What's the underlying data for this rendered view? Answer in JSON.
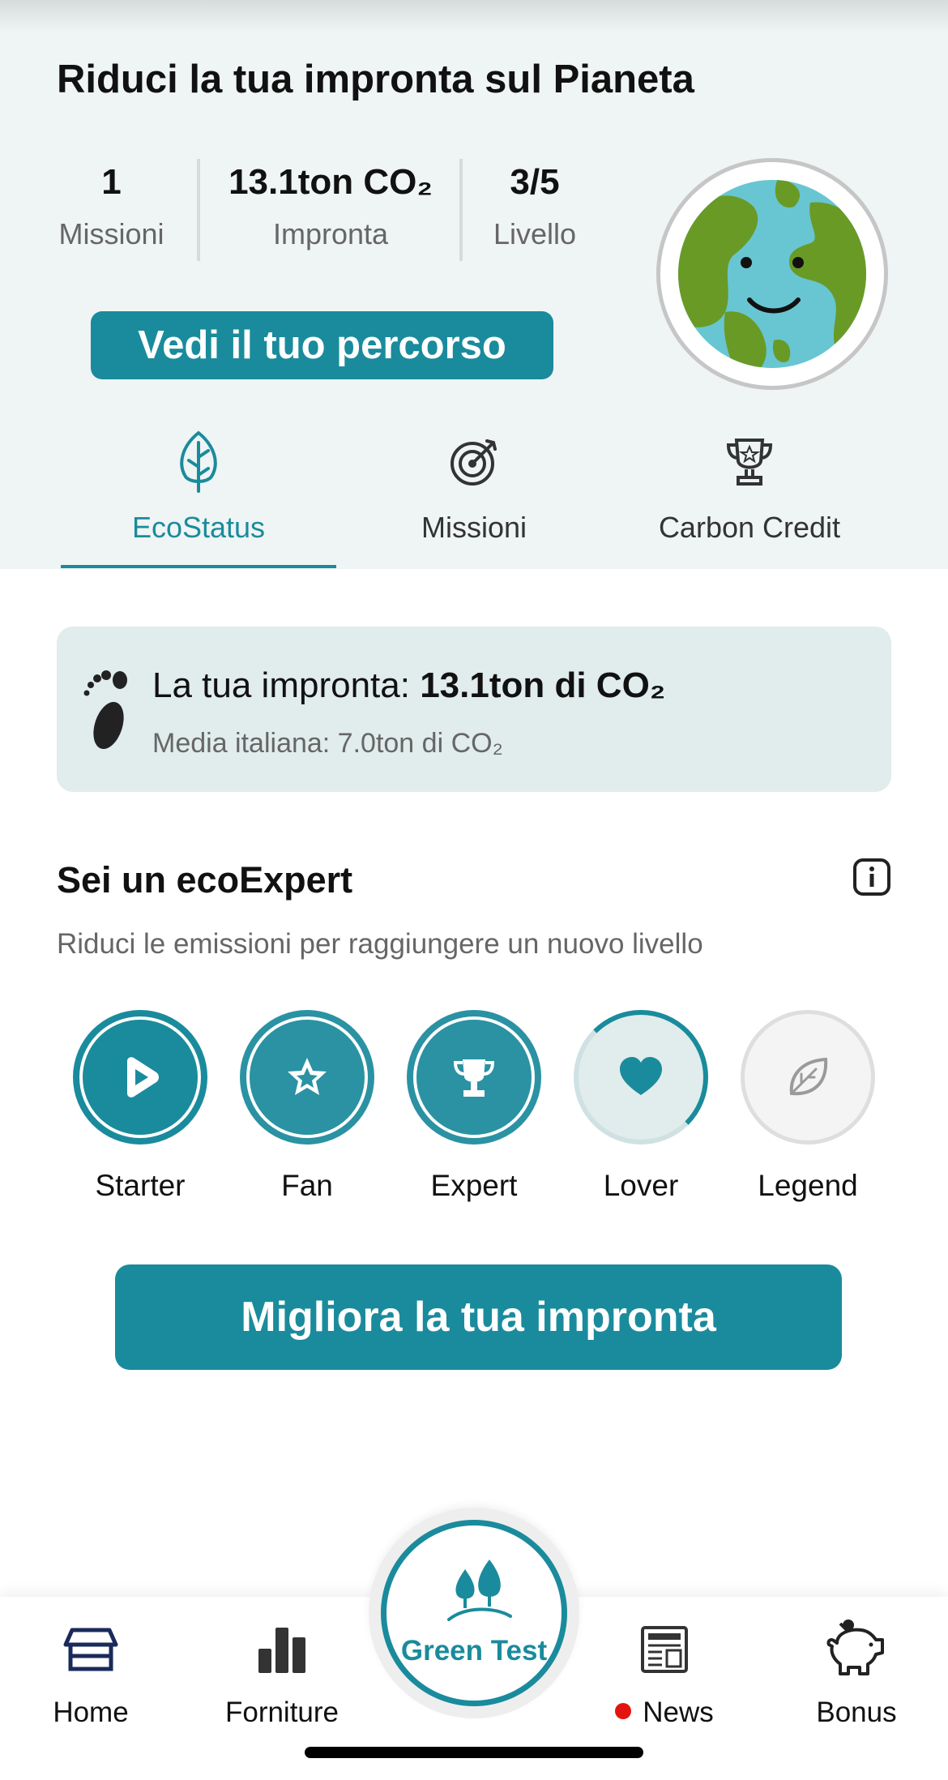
{
  "header": {
    "title": "Riduci la tua impronta sul Pianeta",
    "stats": [
      {
        "value": "1",
        "label": "Missioni"
      },
      {
        "value": "13.1ton CO₂",
        "label": "Impronta"
      },
      {
        "value": "3/5",
        "label": "Livello"
      }
    ],
    "path_button_label": "Vedi il tuo percorso",
    "avatar_icon": "smiling-earth-icon"
  },
  "tabs": [
    {
      "label": "EcoStatus",
      "icon": "leaf-icon",
      "active": true
    },
    {
      "label": "Missioni",
      "icon": "target-icon",
      "active": false
    },
    {
      "label": "Carbon Credit",
      "icon": "trophy-icon",
      "active": false
    }
  ],
  "footprint": {
    "prefix": "La tua impronta: ",
    "value": "13.1ton di CO₂",
    "average": "Media italiana: 7.0ton di CO₂",
    "icon": "footprint-icon"
  },
  "level": {
    "title": "Sei un ecoExpert",
    "subtitle": "Riduci le emissioni per raggiungere un nuovo livello",
    "badges": [
      {
        "label": "Starter",
        "icon": "play-icon",
        "state": "completed"
      },
      {
        "label": "Fan",
        "icon": "star-icon",
        "state": "completed"
      },
      {
        "label": "Expert",
        "icon": "trophy-icon",
        "state": "completed"
      },
      {
        "label": "Lover",
        "icon": "heart-icon",
        "state": "in-progress"
      },
      {
        "label": "Legend",
        "icon": "leaf-icon",
        "state": "locked"
      }
    ]
  },
  "improve_button_label": "Migliora la tua impronta",
  "bottom_nav": {
    "home": "Home",
    "forniture": "Forniture",
    "green_test": "Green Test",
    "news": "News",
    "bonus": "Bonus"
  },
  "colors": {
    "accent": "#1a8b9c",
    "header_bg": "#eff4f4",
    "card_bg": "#e1ecec",
    "notification_dot": "#e3140f"
  }
}
